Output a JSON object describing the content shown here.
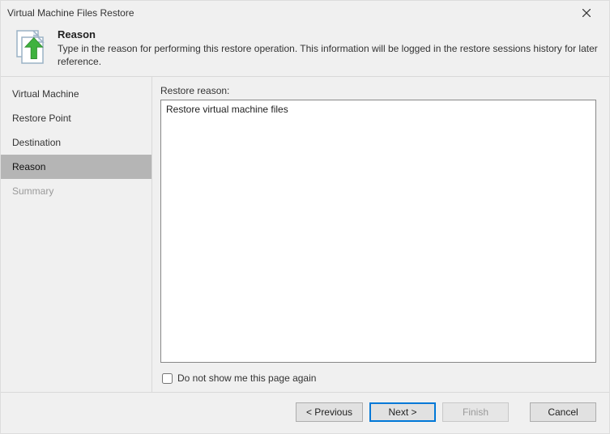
{
  "window": {
    "title": "Virtual Machine Files Restore"
  },
  "header": {
    "title": "Reason",
    "description": "Type in the reason for performing this restore operation. This information will be logged in the restore sessions history for later reference."
  },
  "sidebar": {
    "items": [
      {
        "label": "Virtual Machine",
        "state": "normal"
      },
      {
        "label": "Restore Point",
        "state": "normal"
      },
      {
        "label": "Destination",
        "state": "normal"
      },
      {
        "label": "Reason",
        "state": "active"
      },
      {
        "label": "Summary",
        "state": "disabled"
      }
    ]
  },
  "main": {
    "reason_label": "Restore reason:",
    "reason_value": "Restore virtual machine files",
    "checkbox_label": "Do not show me this page again",
    "checkbox_checked": false
  },
  "footer": {
    "previous": "< Previous",
    "next": "Next >",
    "finish": "Finish",
    "cancel": "Cancel"
  }
}
